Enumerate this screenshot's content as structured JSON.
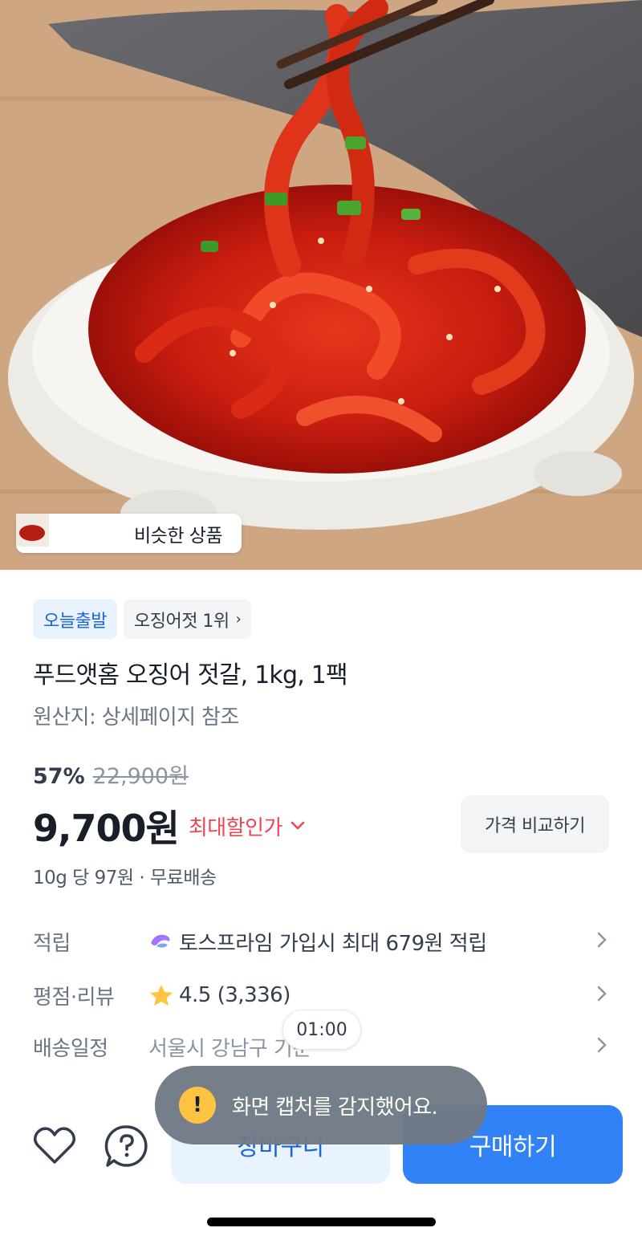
{
  "hero": {
    "image_description": "Red spicy squid jeotgal in a white ceramic bowl lifted with chopsticks",
    "similar_products_label": "비슷한 상품"
  },
  "badges": {
    "today_ship": "오늘출발",
    "ranking": "오징어젓 1위",
    "ranking_chevron": "›"
  },
  "product": {
    "title": "푸드앳홈 오징어 젓갈, 1kg, 1팩",
    "origin": "원산지: 상세페이지 참조",
    "discount_percent": "57%",
    "original_price": "22,900원",
    "price": "9,700원",
    "max_discount_label": "최대할인가",
    "compare_button": "가격 비교하기",
    "unit_price": "10g 당 97원 · 무료배송"
  },
  "details": {
    "points_label": "적립",
    "points_value": "토스프라임 가입시 최대 679원 적립",
    "rating_label": "평점·리뷰",
    "rating_value": "4.5 (3,336)",
    "delivery_label": "배송일정",
    "delivery_value": "서울시 강남구 기준"
  },
  "overlay": {
    "timer": "01:00",
    "toast_icon": "!",
    "toast_text": "화면 캡처를 감지했어요."
  },
  "bottom_bar": {
    "cart_button": "장바구니",
    "buy_button": "구매하기"
  },
  "colors": {
    "accent_blue": "#3182f6",
    "discount_red": "#f04452",
    "toast_bg": "#707985"
  }
}
